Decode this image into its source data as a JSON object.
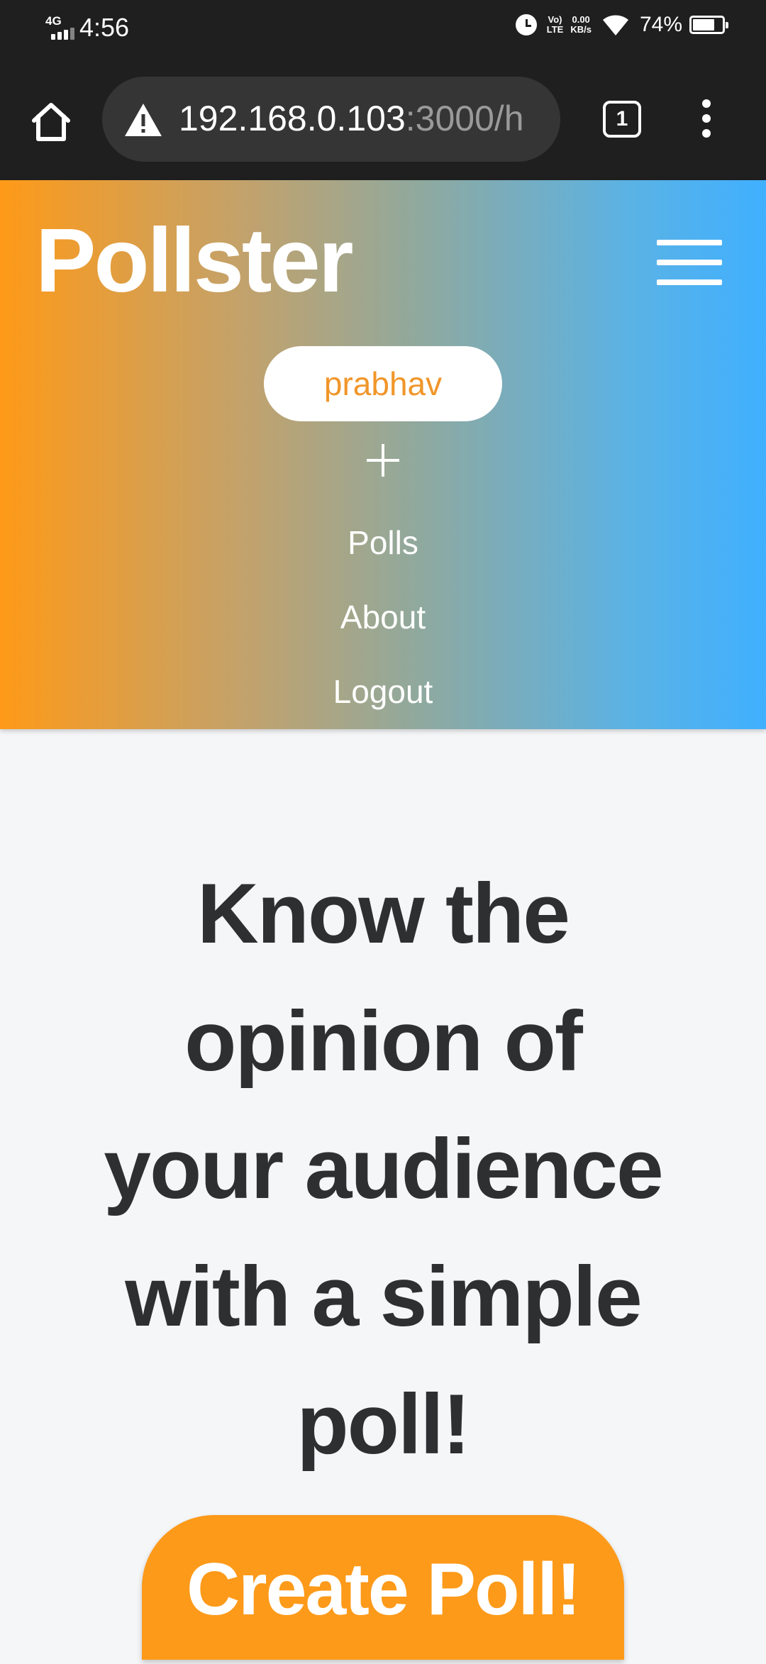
{
  "status_bar": {
    "network": "4G",
    "time": "4:56",
    "volte_top": "Vo)",
    "volte_bottom": "LTE",
    "speed_value": "0.00",
    "speed_unit": "KB/s",
    "battery_percent": "74%",
    "battery_level": 0.74
  },
  "browser": {
    "url_host": "192.168.0.103",
    "url_rest": ":3000/h",
    "tab_count": "1"
  },
  "header": {
    "brand": "Pollster",
    "user_name": "prabhav",
    "nav": [
      {
        "label": "Polls"
      },
      {
        "label": "About"
      },
      {
        "label": "Logout"
      }
    ]
  },
  "hero": {
    "title_lines": [
      "Know the",
      "opinion of",
      "your audience",
      "with a simple",
      "poll!"
    ],
    "cta_label": "Create Poll!"
  },
  "colors": {
    "accent_orange": "#fd9a1a",
    "accent_blue": "#40b0ff",
    "text_dark": "#2e2f30"
  }
}
